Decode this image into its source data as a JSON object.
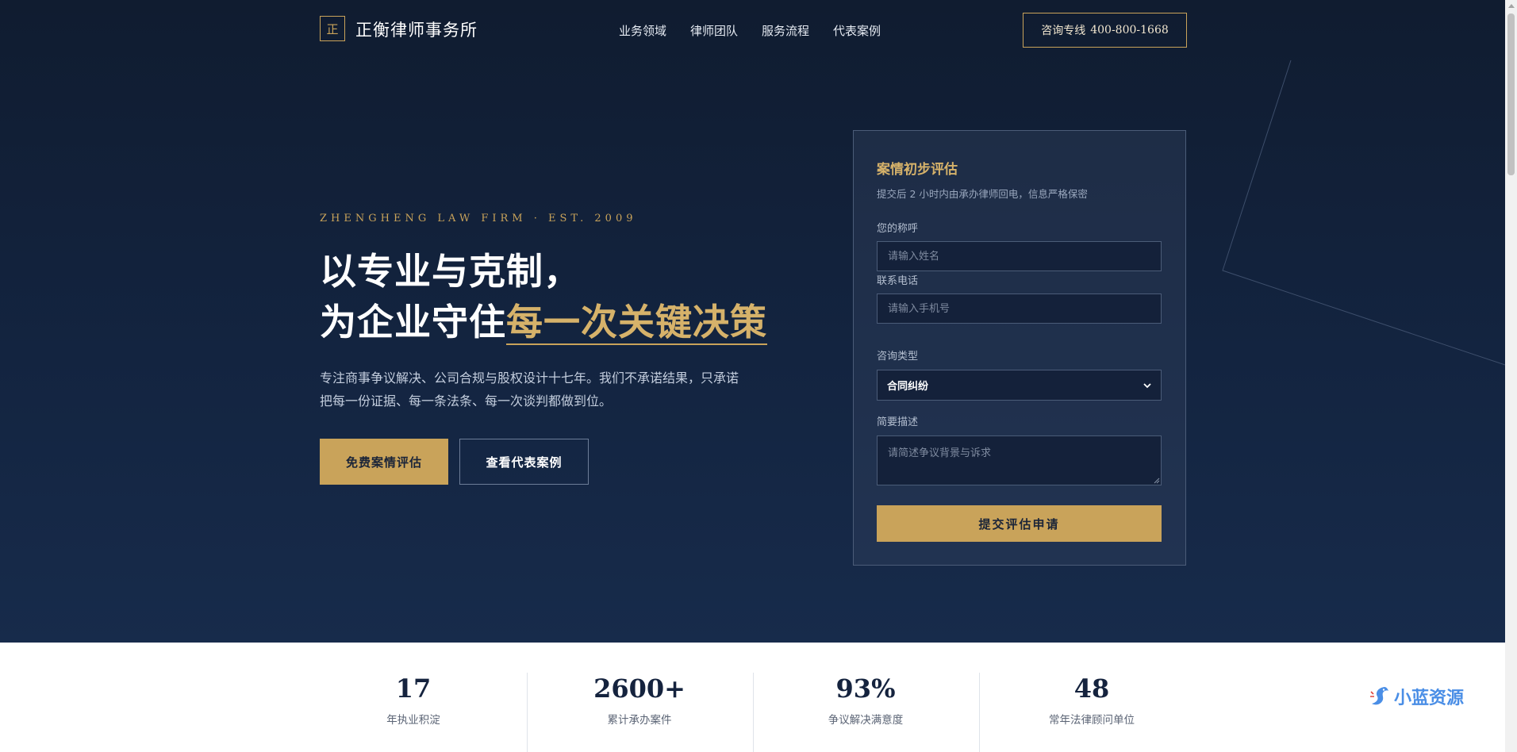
{
  "brand": {
    "mark": "正",
    "name": "正衡律师事务所"
  },
  "nav": {
    "items": [
      "业务领域",
      "律师团队",
      "服务流程",
      "代表案例"
    ]
  },
  "hotline": {
    "label": "咨询专线",
    "number": "400-800-1668"
  },
  "hero": {
    "eyebrow": "ZHENGHENG LAW FIRM · EST. 2009",
    "headline_line1": "以专业与克制，",
    "headline_line2_plain": "为企业守住",
    "headline_line2_accent": "每一次关键决策",
    "lead": "专注商事争议解决、公司合规与股权设计十七年。我们不承诺结果，只承诺把每一份证据、每一条法条、每一次谈判都做到位。",
    "primary_cta": "免费案情评估",
    "secondary_cta": "查看代表案例"
  },
  "form": {
    "title": "案情初步评估",
    "subtitle": "提交后 2 小时内由承办律师回电，信息严格保密",
    "name_label": "您的称呼",
    "name_placeholder": "请输入姓名",
    "phone_label": "联系电话",
    "phone_placeholder": "请输入手机号",
    "type_label": "咨询类型",
    "type_selected": "合同纠纷",
    "desc_label": "简要描述",
    "desc_placeholder": "请简述争议背景与诉求",
    "submit": "提交评估申请"
  },
  "stats": [
    {
      "value": "17",
      "label": "年执业积淀"
    },
    {
      "value": "2600+",
      "label": "累计承办案件"
    },
    {
      "value": "93%",
      "label": "争议解决满意度"
    },
    {
      "value": "48",
      "label": "常年法律顾问单位"
    }
  ],
  "watermark": {
    "text": "小蓝资源"
  },
  "colors": {
    "navy": "#132440",
    "gold": "#c9a35a",
    "gold_text": "#d6b26a",
    "stat_text": "#15233e"
  },
  "icons": {
    "select": "chevron-down-icon",
    "watermark": "dragon-logo-icon"
  }
}
